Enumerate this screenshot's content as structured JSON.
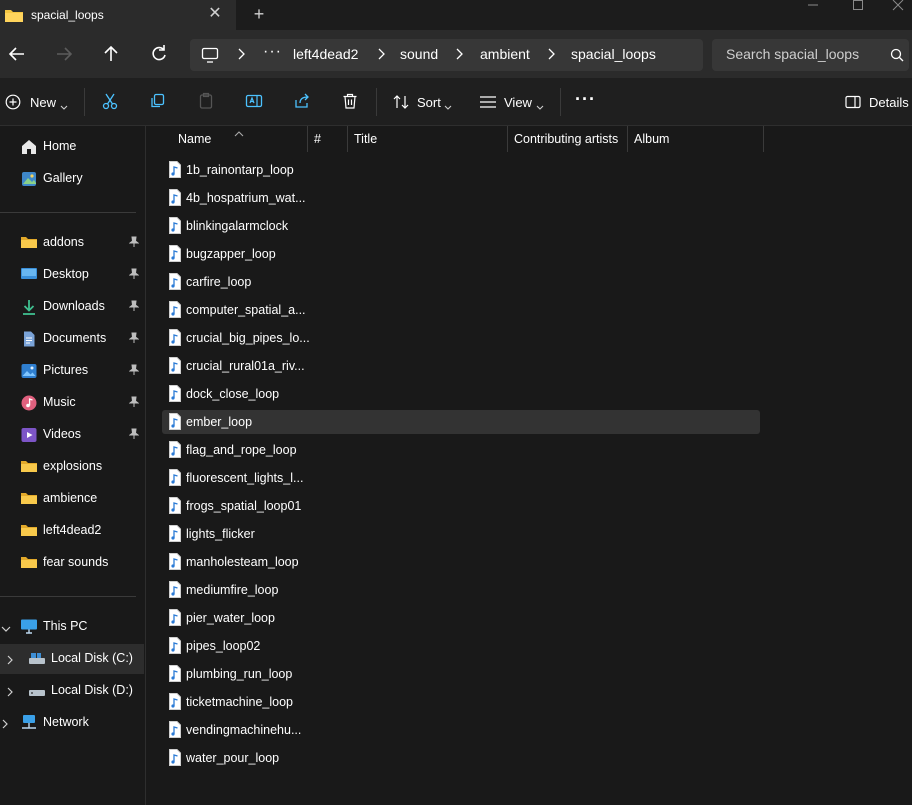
{
  "tab": {
    "title": "spacial_loops",
    "close": "✕",
    "new": "+"
  },
  "address": {
    "crumbs": [
      "left4dead2",
      "sound",
      "ambient",
      "spacial_loops"
    ],
    "overflow": "···"
  },
  "search": {
    "placeholder": "Search spacial_loops"
  },
  "toolbar": {
    "new_label": "New",
    "sort_label": "Sort",
    "view_label": "View",
    "more": "···",
    "details_label": "Details"
  },
  "sidebar": {
    "home": "Home",
    "gallery": "Gallery",
    "quick": [
      {
        "label": "addons"
      },
      {
        "label": "Desktop"
      },
      {
        "label": "Downloads"
      },
      {
        "label": "Documents"
      },
      {
        "label": "Pictures"
      },
      {
        "label": "Music"
      },
      {
        "label": "Videos"
      },
      {
        "label": "explosions"
      },
      {
        "label": "ambience"
      },
      {
        "label": "left4dead2"
      },
      {
        "label": "fear sounds"
      }
    ],
    "this_pc": "This PC",
    "local_c": "Local Disk (C:)",
    "local_d": "Local Disk (D:)",
    "network": "Network"
  },
  "columns": {
    "name": "Name",
    "number": "#",
    "title": "Title",
    "artists": "Contributing artists",
    "album": "Album"
  },
  "files": [
    "1b_rainontarp_loop",
    "4b_hospatrium_wat...",
    "blinkingalarmclock",
    "bugzapper_loop",
    "carfire_loop",
    "computer_spatial_a...",
    "crucial_big_pipes_lo...",
    "crucial_rural01a_riv...",
    "dock_close_loop",
    "ember_loop",
    "flag_and_rope_loop",
    "fluorescent_lights_l...",
    "frogs_spatial_loop01",
    "lights_flicker",
    "manholesteam_loop",
    "mediumfire_loop",
    "pier_water_loop",
    "pipes_loop02",
    "plumbing_run_loop",
    "ticketmachine_loop",
    "vendingmachinehu...",
    "water_pour_loop"
  ],
  "selected_file": "ember_loop",
  "colors": {
    "background": "#191919",
    "folder": "#f4c542",
    "accent": "#4cc2ff"
  }
}
